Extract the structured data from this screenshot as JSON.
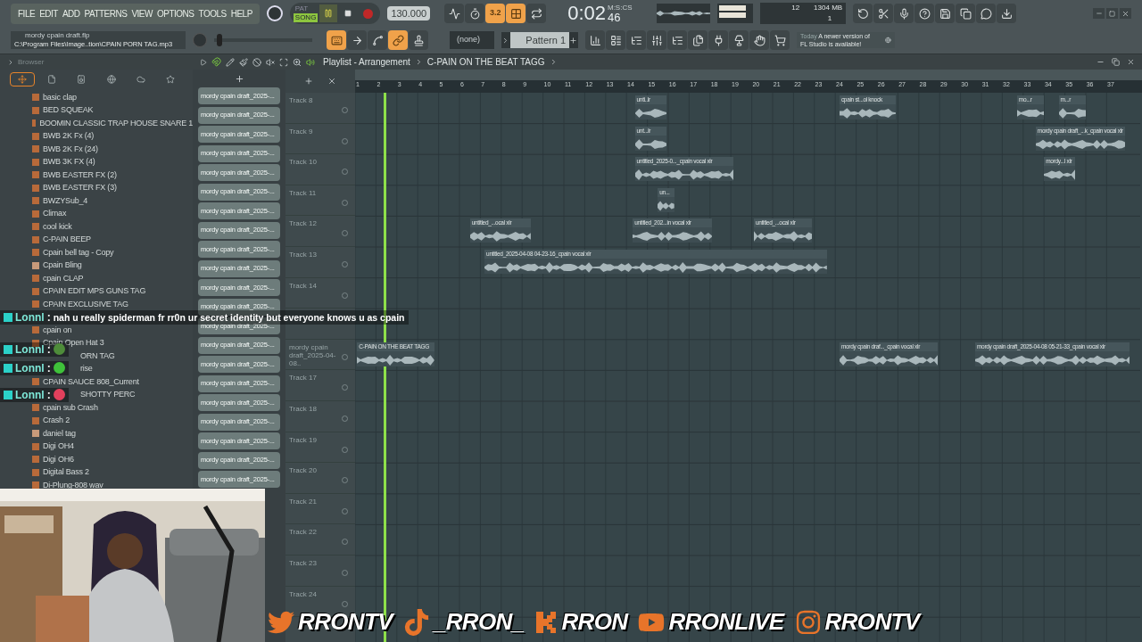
{
  "menu": [
    "FILE",
    "EDIT",
    "ADD",
    "PATTERNS",
    "VIEW",
    "OPTIONS",
    "TOOLS",
    "HELP"
  ],
  "transport": {
    "modes": [
      {
        "label": "PAT",
        "selected": false
      },
      {
        "label": "SONG",
        "selected": true
      }
    ],
    "playing": true,
    "recording": false,
    "tempo": "130.000"
  },
  "song_tools": [
    {
      "kind": "metronome",
      "on": false
    },
    {
      "kind": "wait",
      "on": false
    },
    {
      "kind": "step",
      "label": "3.2",
      "on": true
    },
    {
      "kind": "blend",
      "on": true
    },
    {
      "kind": "loop",
      "on": false
    }
  ],
  "time": {
    "main": "0:02",
    "sub": "46",
    "unit": "M:S:CS"
  },
  "cpu": {
    "voices": "12",
    "memory": "1304 MB",
    "polyphony": "1"
  },
  "app_tools": [
    {
      "kind": "undo"
    },
    {
      "kind": "cut"
    },
    {
      "kind": "mic"
    },
    {
      "kind": "help"
    },
    {
      "kind": "save"
    },
    {
      "kind": "export"
    },
    {
      "kind": "chat"
    },
    {
      "kind": "download"
    }
  ],
  "file": {
    "name": "mordy cpain draft.flp",
    "path": "C:\\Program Files\\Image..tion\\CPAIN PORN TAG.mp3"
  },
  "master": {
    "level": 0.03
  },
  "edit_tools": [
    {
      "kind": "typing",
      "on": true
    },
    {
      "kind": "arrow",
      "on": false
    },
    {
      "kind": "curve",
      "on": false
    },
    {
      "kind": "link",
      "on": true
    },
    {
      "kind": "stamp",
      "on": false
    }
  ],
  "pattern_selector": {
    "value": "(none)"
  },
  "pattern": {
    "value": "Pattern 1"
  },
  "window_tools": [
    {
      "kind": "playlist"
    },
    {
      "kind": "steps"
    },
    {
      "kind": "rack"
    },
    {
      "kind": "mixer"
    },
    {
      "kind": "tree"
    },
    {
      "kind": "files"
    },
    {
      "kind": "plugin"
    },
    {
      "kind": "lamp"
    },
    {
      "kind": "hand"
    },
    {
      "kind": "cart"
    }
  ],
  "hint": {
    "date": "Today",
    "message": "A newer version of FL Studio is available!"
  },
  "browser": {
    "title": "Browser",
    "tabs": [
      {
        "kind": "all",
        "selected": true
      },
      {
        "kind": "file",
        "selected": false
      },
      {
        "kind": "speaker",
        "selected": false
      },
      {
        "kind": "globe",
        "selected": false
      },
      {
        "kind": "cloud",
        "selected": false
      },
      {
        "kind": "star",
        "selected": false
      }
    ],
    "items": [
      {
        "kind": "wav",
        "label": "basic clap"
      },
      {
        "kind": "wav",
        "label": "BED SQUEAK"
      },
      {
        "kind": "wav",
        "label": "BOOMIN CLASSIC TRAP HOUSE SNARE 1"
      },
      {
        "kind": "wav",
        "label": "BWB 2K Fx (4)"
      },
      {
        "kind": "wav",
        "label": "BWB 2K Fx (24)"
      },
      {
        "kind": "wav",
        "label": "BWB 3K FX (4)"
      },
      {
        "kind": "wav",
        "label": "BWB EASTER FX (2)"
      },
      {
        "kind": "wav",
        "label": "BWB EASTER FX (3)"
      },
      {
        "kind": "wav",
        "label": "BWZYSub_4"
      },
      {
        "kind": "wav",
        "label": "Climax"
      },
      {
        "kind": "wav",
        "label": "cool kick"
      },
      {
        "kind": "wav",
        "label": "C-PAIN BEEP"
      },
      {
        "kind": "wav",
        "label": "Cpain bell tag - Copy"
      },
      {
        "kind": "mp3",
        "label": "Cpain Bling"
      },
      {
        "kind": "wav",
        "label": "cpain CLAP"
      },
      {
        "kind": "wav",
        "label": "CPAIN EDIT MPS GUNS TAG"
      },
      {
        "kind": "wav",
        "label": "CPAIN EXCLUSIVE TAG"
      },
      {
        "kind": "covered"
      },
      {
        "kind": "wav",
        "label": "cpain on"
      },
      {
        "kind": "wav",
        "label": "Cpain Open Hat 3"
      },
      {
        "kind": "covered",
        "label": "ORN TAG"
      },
      {
        "kind": "covered",
        "label": "rise"
      },
      {
        "kind": "wav",
        "label": "CPAIN SAUCE 808_Current"
      },
      {
        "kind": "covered",
        "label": "SHOTTY PERC"
      },
      {
        "kind": "wav",
        "label": "cpain sub Crash"
      },
      {
        "kind": "wav",
        "label": "Crash 2"
      },
      {
        "kind": "mp3",
        "label": "daniel tag"
      },
      {
        "kind": "wav",
        "label": "Digi OH4"
      },
      {
        "kind": "wav",
        "label": "Digi OH6"
      },
      {
        "kind": "wav",
        "label": "Digital Bass 2"
      },
      {
        "kind": "wav",
        "label": "Di-Plung-808 wav"
      }
    ]
  },
  "channels": [
    "mordy cpain draft_2025-...",
    "mordy cpain draft_2025-...",
    "mordy cpain draft_2025-...",
    "mordy cpain draft_2025-...",
    "mordy cpain draft_2025-...",
    "mordy cpain draft_2025-...",
    "mordy cpain draft_2025-...",
    "mordy cpain draft_2025-...",
    "mordy cpain draft_2025-...",
    "mordy cpain draft_2025-...",
    "mordy cpain draft_2025-...",
    "mordy cpain draft_2025-...",
    "mordy cpain draft_2025-...",
    "mordy cpain draft_2025-...",
    "mordy cpain draft_2025-...",
    "mordy cpain draft_2025-...",
    "mordy cpain draft_2025-...",
    "mordy cpain draft_2025-...",
    "mordy cpain draft_2025-...",
    "mordy cpain draft_2025-...",
    "mordy cpain draft_2025-..."
  ],
  "playlist": {
    "title": "Playlist - Arrangement",
    "pattern": "C-PAIN ON THE BEAT TAGG",
    "ruler": [
      "1",
      "2",
      "3",
      "4",
      "5",
      "6",
      "7",
      "8",
      "9",
      "10",
      "11",
      "12",
      "13",
      "14",
      "15",
      "16",
      "17",
      "18",
      "19",
      "20",
      "21",
      "22",
      "23",
      "24",
      "25",
      "26",
      "27",
      "28",
      "29",
      "30",
      "31",
      "32",
      "33",
      "34",
      "35",
      "36",
      "37"
    ],
    "tracks": [
      {
        "name": "Track 8",
        "clips": [
          "unti..lr",
          "cpain st...ol knock",
          "mo...r",
          "m...r"
        ]
      },
      {
        "name": "Track 9",
        "clips": [
          "unt...lr",
          "mordy cpain draft_...k_cpain vocal xlr"
        ]
      },
      {
        "name": "Track 10",
        "clips": [
          "untitled_2025-0..._cpain vocal xlr",
          "mordy...l xlr"
        ]
      },
      {
        "name": "Track 11",
        "clips": [
          "un..."
        ]
      },
      {
        "name": "Track 12",
        "clips": [
          "untitled_...ocal xlr",
          "untitled_202...in vocal xlr",
          "untitled_...ocal xlr"
        ]
      },
      {
        "name": "Track 13",
        "clips": [
          "untitled_2025-04-08 04-23-16_cpain vocal xlr"
        ]
      },
      {
        "name": "Track 14"
      },
      {
        "kind": "covered"
      },
      {
        "name": "mordy cpain draft_2025-04-08..",
        "clips": [
          "C-PAIN ON THE BEAT TAGG",
          "mordy cpain draf..._cpain vocal xlr",
          "mordy cpain draft_2025-04-08 05-21-33_cpain vocal xlr"
        ]
      },
      {
        "name": "Track 17"
      },
      {
        "name": "Track 18"
      },
      {
        "name": "Track 19"
      },
      {
        "name": "Track 20"
      },
      {
        "name": "Track 21"
      },
      {
        "name": "Track 22"
      },
      {
        "name": "Track 23"
      },
      {
        "name": "Track 24"
      }
    ]
  },
  "chat": [
    {
      "kind": "text",
      "user": "Lonnl",
      "separator": ":",
      "message": "nah u really spiderman fr rr0n ur secret identity but everyone knows u as cpain"
    },
    {
      "kind": "emote",
      "user": "Lonnl",
      "separator": ":",
      "color": "#4e8c3a"
    },
    {
      "kind": "emote",
      "user": "Lonnl",
      "separator": ":",
      "color": "#3fc23a"
    },
    {
      "kind": "emote",
      "user": "Lonnl",
      "separator": ":",
      "color": "#e2405c"
    }
  ],
  "socials": [
    {
      "kind": "twitter",
      "handle": "RRONTV"
    },
    {
      "kind": "tiktok",
      "handle": "_RRON_"
    },
    {
      "kind": "kick",
      "handle": "RRON"
    },
    {
      "kind": "youtube",
      "handle": "RRONLIVE"
    },
    {
      "kind": "instagram",
      "handle": "RRONTV"
    }
  ]
}
